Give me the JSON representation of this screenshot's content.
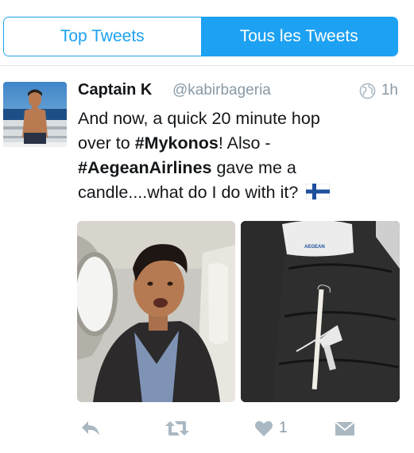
{
  "tabs": [
    {
      "label": "Top Tweets",
      "active": false
    },
    {
      "label": "Tous les Tweets",
      "active": true
    }
  ],
  "tweet": {
    "author_name": "Captain K",
    "handle": "@kabirbageria",
    "time": "1h",
    "text_lines": [
      {
        "plain": "And now, a quick 20 minute hop"
      },
      {
        "before": "over to ",
        "hashtag": "#Mykonos",
        "after": "! Also -"
      },
      {
        "hashtag": "#AegeanAirlines",
        "after": " gave me a"
      },
      {
        "before": "candle....what do I do with it? "
      }
    ],
    "flag_icon": "finland-flag-icon",
    "media": [
      "selfie-photo",
      "candle-on-seat-photo"
    ],
    "candle_label": "AEGEAN",
    "actions": {
      "reply_icon": "reply-icon",
      "retweet_icon": "retweet-icon",
      "like_icon": "heart-icon",
      "like_count": "1",
      "dm_icon": "envelope-icon"
    }
  },
  "colors": {
    "accent": "#1da1f2",
    "secondary_text": "#8899a6",
    "action_gray": "#aab8c2"
  }
}
